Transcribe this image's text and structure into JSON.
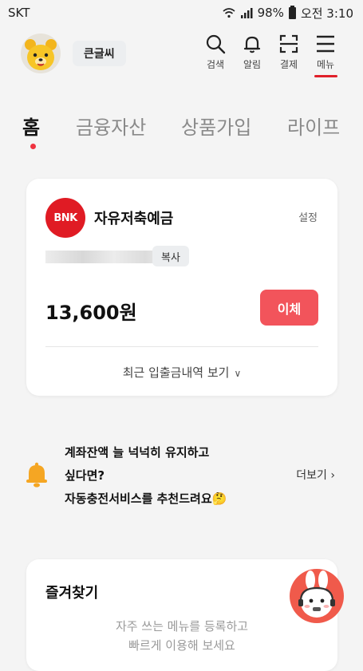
{
  "status_bar": {
    "carrier": "SKT",
    "battery": "98%",
    "time": "오전 3:10"
  },
  "header": {
    "nickname": "큰글씨",
    "buttons": [
      {
        "id": "search",
        "label": "검색",
        "icon": "search-icon"
      },
      {
        "id": "alerts",
        "label": "알림",
        "icon": "bell-icon"
      },
      {
        "id": "pay",
        "label": "결제",
        "icon": "scan-icon"
      },
      {
        "id": "menu",
        "label": "메뉴",
        "icon": "hamburger-icon"
      }
    ]
  },
  "tabs": [
    {
      "label": "홈",
      "active": true
    },
    {
      "label": "금융자산",
      "active": false
    },
    {
      "label": "상품가입",
      "active": false
    },
    {
      "label": "라이프",
      "active": false
    }
  ],
  "account": {
    "bank_logo": "BNK",
    "name": "자유저축예금",
    "settings": "설정",
    "copy": "복사",
    "balance": "13,600원",
    "transfer": "이체",
    "history": "최근 입출금내역 보기"
  },
  "banner": {
    "line1": "계좌잔액 늘 넉넉히 유지하고",
    "line2": "싶다면?",
    "line3": "자동충전서비스를 추천드려요🤔",
    "more": "더보기"
  },
  "favorites": {
    "title": "즐겨찾기",
    "desc_line1": "자주 쓰는 메뉴를 등록하고",
    "desc_line2": "빠르게 이용해 보세요"
  },
  "colors": {
    "accent_red": "#e01b24",
    "transfer_button": "#f2545b",
    "bell_yellow": "#f5a623"
  }
}
